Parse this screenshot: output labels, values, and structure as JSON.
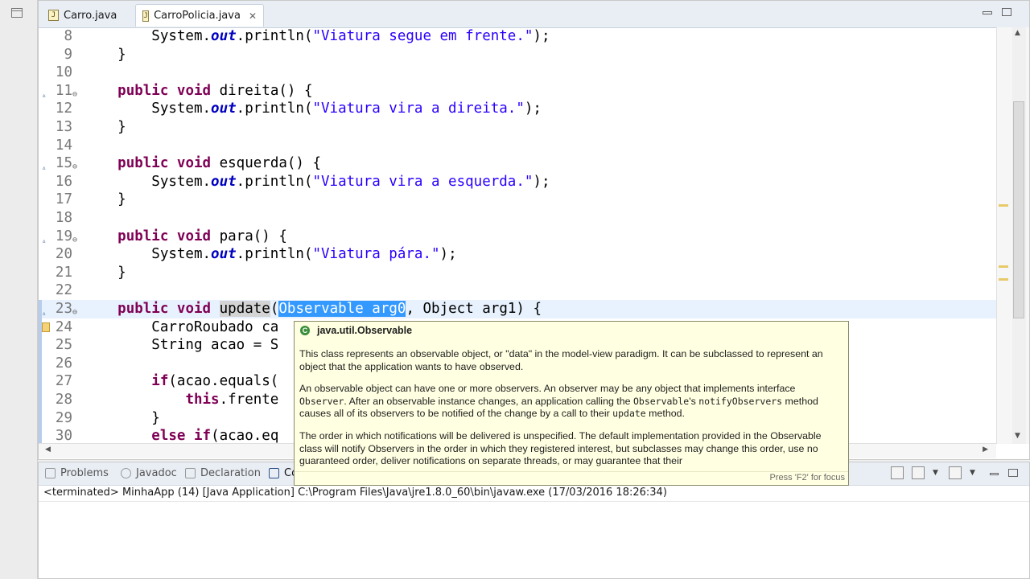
{
  "tabs": [
    {
      "label": "Carro.java",
      "active": false
    },
    {
      "label": "CarroPolicia.java",
      "active": true
    }
  ],
  "code_lines": [
    {
      "num": "8",
      "tokens": [
        [
          "",
          "        System."
        ],
        [
          "fld",
          "out"
        ],
        [
          "",
          ".println("
        ],
        [
          "str",
          "\"Viatura segue em frente.\""
        ],
        [
          "",
          ");"
        ]
      ]
    },
    {
      "num": "9",
      "tokens": [
        [
          "",
          "    }"
        ]
      ]
    },
    {
      "num": "10",
      "tokens": []
    },
    {
      "num": "11",
      "marker": "override",
      "fold": true,
      "tokens": [
        [
          "",
          "    "
        ],
        [
          "kw",
          "public"
        ],
        [
          "",
          " "
        ],
        [
          "kw",
          "void"
        ],
        [
          "",
          " direita() {"
        ]
      ]
    },
    {
      "num": "12",
      "tokens": [
        [
          "",
          "        System."
        ],
        [
          "fld",
          "out"
        ],
        [
          "",
          ".println("
        ],
        [
          "str",
          "\"Viatura vira a direita.\""
        ],
        [
          "",
          ");"
        ]
      ]
    },
    {
      "num": "13",
      "tokens": [
        [
          "",
          "    }"
        ]
      ]
    },
    {
      "num": "14",
      "tokens": []
    },
    {
      "num": "15",
      "marker": "override",
      "fold": true,
      "tokens": [
        [
          "",
          "    "
        ],
        [
          "kw",
          "public"
        ],
        [
          "",
          " "
        ],
        [
          "kw",
          "void"
        ],
        [
          "",
          " esquerda() {"
        ]
      ]
    },
    {
      "num": "16",
      "tokens": [
        [
          "",
          "        System."
        ],
        [
          "fld",
          "out"
        ],
        [
          "",
          ".println("
        ],
        [
          "str",
          "\"Viatura vira a esquerda.\""
        ],
        [
          "",
          ");"
        ]
      ]
    },
    {
      "num": "17",
      "tokens": [
        [
          "",
          "    }"
        ]
      ]
    },
    {
      "num": "18",
      "tokens": []
    },
    {
      "num": "19",
      "marker": "override",
      "fold": true,
      "tokens": [
        [
          "",
          "    "
        ],
        [
          "kw",
          "public"
        ],
        [
          "",
          " "
        ],
        [
          "kw",
          "void"
        ],
        [
          "",
          " para() {"
        ]
      ]
    },
    {
      "num": "20",
      "tokens": [
        [
          "",
          "        System."
        ],
        [
          "fld",
          "out"
        ],
        [
          "",
          ".println("
        ],
        [
          "str",
          "\"Viatura pára.\""
        ],
        [
          "",
          ");"
        ]
      ]
    },
    {
      "num": "21",
      "tokens": [
        [
          "",
          "    }"
        ]
      ]
    },
    {
      "num": "22",
      "tokens": []
    },
    {
      "num": "23",
      "marker": "override",
      "fold": true,
      "current": true,
      "tokens": [
        [
          "",
          "    "
        ],
        [
          "kw",
          "public"
        ],
        [
          "",
          " "
        ],
        [
          "kw",
          "void"
        ],
        [
          "",
          " "
        ],
        [
          "occ",
          "update"
        ],
        [
          "",
          "("
        ],
        [
          "sel",
          "Observable arg0"
        ],
        [
          "",
          ", Object arg1) {"
        ]
      ]
    },
    {
      "num": "24",
      "marker": "warning",
      "tokens": [
        [
          "",
          "        CarroRoubado ca"
        ]
      ]
    },
    {
      "num": "25",
      "tokens": [
        [
          "",
          "        String acao = S"
        ]
      ]
    },
    {
      "num": "26",
      "tokens": []
    },
    {
      "num": "27",
      "tokens": [
        [
          "",
          "        "
        ],
        [
          "kw",
          "if"
        ],
        [
          "",
          "(acao.equals("
        ]
      ]
    },
    {
      "num": "28",
      "tokens": [
        [
          "",
          "            "
        ],
        [
          "kw",
          "this"
        ],
        [
          "",
          ".frente"
        ]
      ]
    },
    {
      "num": "29",
      "tokens": [
        [
          "",
          "        }"
        ]
      ]
    },
    {
      "num": "30",
      "tokens": [
        [
          "",
          "        "
        ],
        [
          "kw",
          "else"
        ],
        [
          "",
          " "
        ],
        [
          "kw",
          "if"
        ],
        [
          "",
          "(acao.eq"
        ]
      ]
    }
  ],
  "javadoc": {
    "title": "java.util.Observable",
    "p1": "This class represents an observable object, or \"data\" in the model-view paradigm. It can be subclassed to represent an object that the application wants to have observed.",
    "p2_a": "An observable object can have one or more observers. An observer may be any object that implements interface",
    "p2_code1": "Observer",
    "p2_b": ". After an observable instance changes, an application calling the",
    "p2_code2": "Observable",
    "p2_c": "'s",
    "p2_code3": "notifyObservers",
    "p2_d": "method causes all of its observers to be notified of the change by a call to their",
    "p2_code4": "update",
    "p2_e": "method.",
    "p3": "The order in which notifications will be delivered is unspecified. The default implementation provided in the Observable class will notify Observers in the order in which they registered interest, but subclasses may change this order, use no guaranteed order, deliver notifications on separate threads, or may guarantee that their",
    "footer": "Press 'F2' for focus"
  },
  "console": {
    "tabs": [
      "Problems",
      "Javadoc",
      "Declaration",
      "Co"
    ],
    "status": "<terminated> MinhaApp (14) [Java Application] C:\\Program Files\\Java\\jre1.8.0_60\\bin\\javaw.exe (17/03/2016 18:26:34)"
  }
}
